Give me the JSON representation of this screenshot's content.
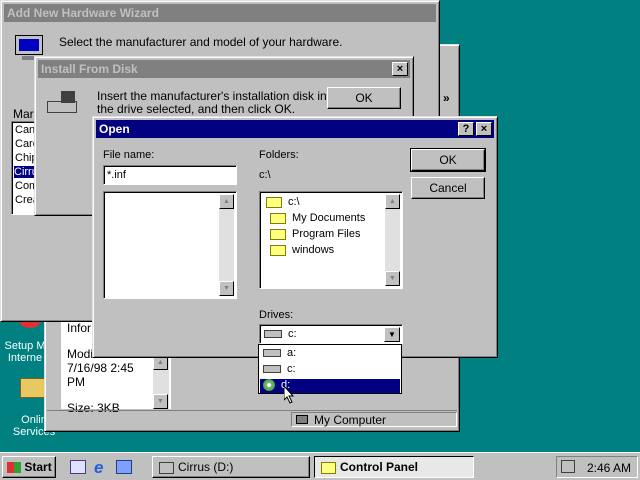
{
  "desktop": {
    "icons": [
      {
        "label_line1": "Setup M",
        "label_line2": "Interne"
      },
      {
        "label_line1": "Onlin",
        "label_line2": "Services"
      }
    ]
  },
  "wizard": {
    "title": "Add New Hardware Wizard",
    "prompt": "Select the manufacturer and model of your hardware.",
    "manufacturers_label": "Mar",
    "manufacturers": [
      "Cano",
      "Carc",
      "Chip",
      "Cirru",
      "Com",
      "Crea"
    ]
  },
  "folder_window": {
    "info_label": "Infor",
    "modified_label": "Modi",
    "modified_value_1": "7/16/98 2:45",
    "modified_value_2": "PM",
    "size_label": "Size: 3KB",
    "status_text": "My Computer",
    "chevron": "»"
  },
  "install_from_disk": {
    "title": "Install From Disk",
    "message_line1": "Insert the manufacturer's installation disk into",
    "message_line2": "the drive selected, and then click OK.",
    "ok_label": "OK"
  },
  "open_dialog": {
    "title": "Open",
    "help_label": "?",
    "close_label": "×",
    "file_name_label": "File name:",
    "file_name_value": "*.inf",
    "folders_label": "Folders:",
    "current_path": "c:\\",
    "folders": [
      "c:\\",
      "My Documents",
      "Program Files",
      "windows"
    ],
    "drives_label": "Drives:",
    "drive_selected": "c:",
    "drive_options": [
      "a:",
      "c:",
      "d:"
    ],
    "ok_label": "OK",
    "cancel_label": "Cancel"
  },
  "taskbar": {
    "start_label": "Start",
    "tasks": [
      "Cirrus (D:)",
      "Control Panel"
    ],
    "clock": "2:46 AM"
  },
  "colors": {
    "desktop": "#008080",
    "active_title": "#000080",
    "inactive_title": "#808080",
    "selection": "#000080"
  }
}
